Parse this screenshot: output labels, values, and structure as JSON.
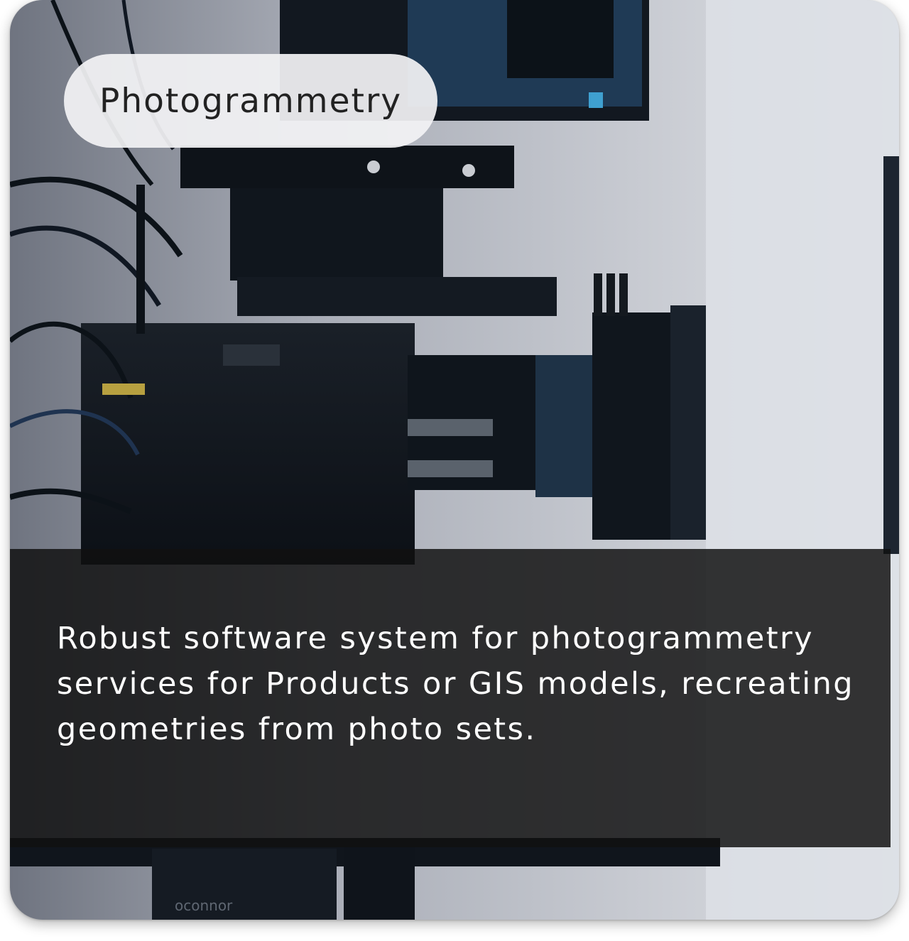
{
  "card": {
    "tag": "Photogrammetry",
    "description": "Robust software system for photogrammetry services for Products or GIS models, recreating geometries from photo sets.",
    "image_brand_text": "oconnor"
  },
  "colors": {
    "pill_background": "#f2f2f4",
    "pill_text": "#222222",
    "caption_panel": "#111111",
    "caption_text": "#ffffff"
  }
}
